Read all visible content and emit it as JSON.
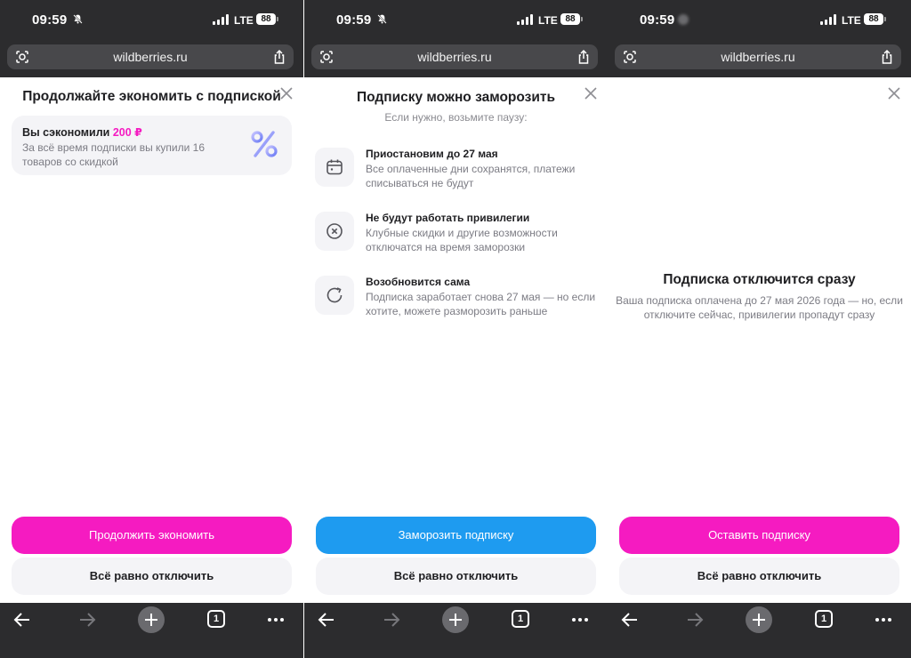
{
  "colors": {
    "chrome": "#2c2c2e",
    "pink_accent": "#f51bc1",
    "blue_accent": "#1e9bf0",
    "card_bg": "#f4f4f7"
  },
  "phones": [
    {
      "status": {
        "time": "09:59",
        "network": "LTE",
        "battery": "88"
      },
      "url": "wildberries.ru",
      "sheet": {
        "title": "Продолжайте экономить с подпиской",
        "card": {
          "title_prefix": "Вы сэкономили",
          "amount": "200 ₽",
          "description": "За всё время подписки вы купили 16 товаров со скидкой",
          "icon": "percent-icon"
        }
      },
      "primary_button": "Продолжить экономить",
      "secondary_button": "Всё равно отключить"
    },
    {
      "status": {
        "time": "09:59",
        "network": "LTE",
        "battery": "88"
      },
      "url": "wildberries.ru",
      "sheet": {
        "title": "Подписку можно заморозить",
        "subtitle": "Если нужно, возьмите паузу:",
        "features": [
          {
            "icon": "calendar-icon",
            "title": "Приостановим до 27 мая",
            "description": "Все оплаченные дни сохранятся, платежи списываться не будут"
          },
          {
            "icon": "cancel-circle-icon",
            "title": "Не будут работать привилегии",
            "description": "Клубные скидки и другие возможности отключатся на время заморозки"
          },
          {
            "icon": "refresh-icon",
            "title": "Возобновится сама",
            "description": "Подписка заработает снова 27 мая — но если хотите, можете разморозить раньше"
          }
        ]
      },
      "primary_button": "Заморозить подписку",
      "secondary_button": "Всё равно отключить"
    },
    {
      "status": {
        "time": "09:59",
        "network": "LTE",
        "battery": "88"
      },
      "url": "wildberries.ru",
      "sheet": {
        "title": "Подписка отключится сразу",
        "description": "Ваша подписка оплачена до 27 мая 2026 года — но, если отключите сейчас, привилегии пропадут сразу"
      },
      "primary_button": "Оставить подписку",
      "secondary_button": "Всё равно отключить"
    }
  ],
  "toolbar": {
    "tabs_count": "1"
  }
}
